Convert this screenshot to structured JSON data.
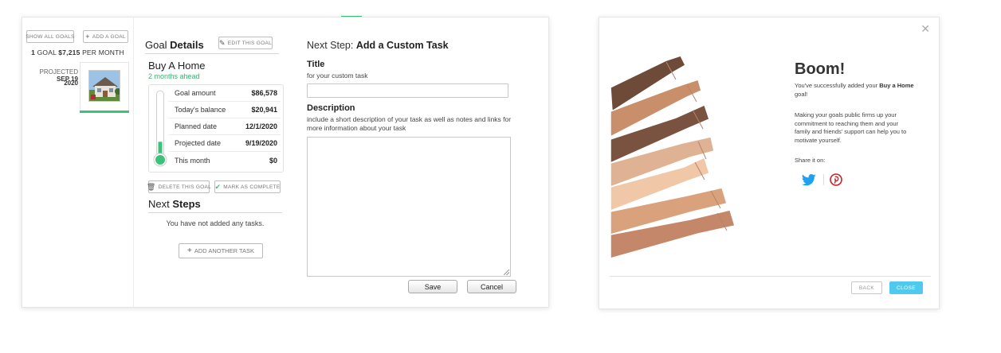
{
  "left": {
    "show_all_goals": "SHOW ALL GOALS",
    "add_a_goal": "ADD A GOAL",
    "summary_count": "1",
    "summary_goal_word": "GOAL",
    "summary_amount": "$7,215",
    "summary_suffix": "PER MONTH",
    "projected_label": "PROJECTED",
    "projected_date_1": "SEP 19",
    "projected_date_2": "2020"
  },
  "details": {
    "heading_1": "Goal",
    "heading_2": "Details",
    "edit_button": "EDIT THIS GOAL",
    "goal_name": "Buy A Home",
    "goal_status": "2 months ahead",
    "thermometer_fill": 0.24,
    "rows": [
      {
        "label": "Goal amount",
        "value": "$86,578"
      },
      {
        "label": "Today's balance",
        "value": "$20,941"
      },
      {
        "label": "Planned date",
        "value": "12/1/2020"
      },
      {
        "label": "Projected date",
        "value": "9/19/2020"
      },
      {
        "label": "This month",
        "value": "$0"
      }
    ],
    "delete_button": "DELETE THIS GOAL",
    "complete_button": "MARK AS COMPLETE",
    "next_1": "Next",
    "next_2": "Steps",
    "empty_tasks": "You have not added any tasks.",
    "add_task": "ADD ANOTHER TASK"
  },
  "form": {
    "title_prefix": "Next Step:",
    "title_main": "Add a Custom Task",
    "title_label": "Title",
    "title_sub": "for your custom task",
    "title_value": "",
    "desc_label": "Description",
    "desc_sub": "include a short description of your task as well as notes and links for more information about your task",
    "save": "Save",
    "cancel": "Cancel"
  },
  "modal": {
    "heading": "Boom!",
    "line1_pre": "You've successfully added your",
    "line1_goal": "Buy a Home",
    "line1_post": "goal!",
    "paragraph": "Making your goals public firms up your commitment to reaching them and your family and friends' support can help you to motivate yourself.",
    "share_label": "Share it on:",
    "back": "BACK",
    "close": "CLOSE"
  }
}
